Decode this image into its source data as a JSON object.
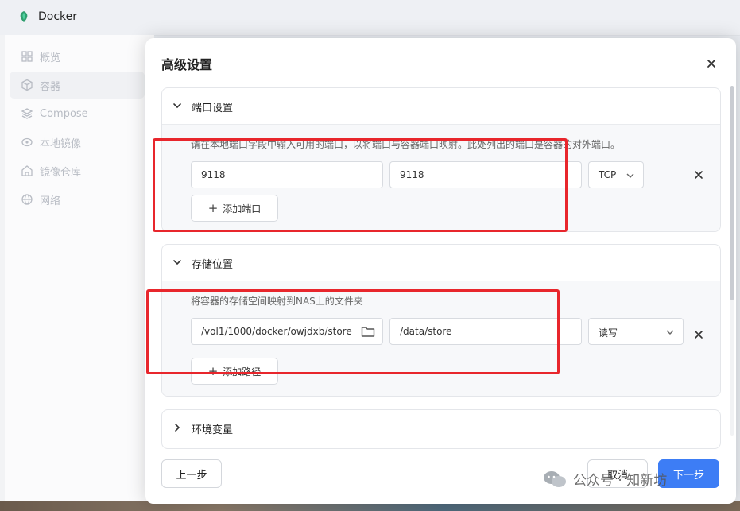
{
  "app": {
    "title": "Docker"
  },
  "sidebar": {
    "items": [
      {
        "label": "概览",
        "icon": "grid-icon"
      },
      {
        "label": "容器",
        "icon": "cube-icon"
      },
      {
        "label": "Compose",
        "icon": "layers-icon"
      },
      {
        "label": "本地镜像",
        "icon": "disc-icon"
      },
      {
        "label": "镜像仓库",
        "icon": "home-icon"
      },
      {
        "label": "网络",
        "icon": "globe-icon"
      }
    ]
  },
  "dialog": {
    "title": "高级设置",
    "ports": {
      "section_label": "端口设置",
      "description": "请在本地端口字段中输入可用的端口，以将端口与容器端口映射。此处列出的端口是容器的对外端口。",
      "rows": [
        {
          "local": "9118",
          "container": "9118",
          "protocol": "TCP"
        }
      ],
      "add_label": "添加端口"
    },
    "storage": {
      "section_label": "存储位置",
      "description": "将容器的存储空间映射到NAS上的文件夹",
      "rows": [
        {
          "host_path": "/vol1/1000/docker/owjdxb/store",
          "container_path": "/data/store",
          "mode": "读写"
        }
      ],
      "add_label": "添加路径"
    },
    "env": {
      "section_label": "环境变量"
    },
    "footer": {
      "prev": "上一步",
      "cancel": "取消",
      "next": "下一步"
    }
  },
  "watermark": {
    "text": "公众号 · 知新坊"
  },
  "colors": {
    "accent": "#3d7df5",
    "highlight": "#e8262c"
  }
}
